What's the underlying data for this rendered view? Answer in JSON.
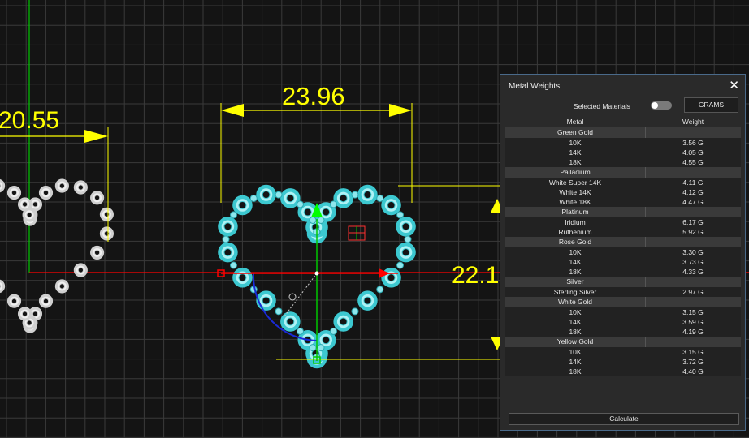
{
  "viewport": {
    "dimension_left": "20.55",
    "dimension_center": "23.96",
    "dimension_right": "22.1"
  },
  "panel": {
    "title": "Metal Weights",
    "close_icon": "close-icon",
    "selected_materials_label": "Selected Materials",
    "units_button": "GRAMS",
    "column_metal": "Metal",
    "column_weight": "Weight",
    "calculate_label": "Calculate",
    "groups": [
      {
        "name": "Green Gold",
        "rows": [
          {
            "metal": "10K",
            "weight": "3.56 G"
          },
          {
            "metal": "14K",
            "weight": "4.05 G"
          },
          {
            "metal": "18K",
            "weight": "4.55 G"
          }
        ]
      },
      {
        "name": "Palladium",
        "rows": [
          {
            "metal": "White Super 14K",
            "weight": "4.11 G"
          },
          {
            "metal": "White 14K",
            "weight": "4.12 G"
          },
          {
            "metal": "White 18K",
            "weight": "4.47 G"
          }
        ]
      },
      {
        "name": "Platinum",
        "rows": [
          {
            "metal": "Iridium",
            "weight": "6.17 G"
          },
          {
            "metal": "Ruthenium",
            "weight": "5.92 G"
          }
        ]
      },
      {
        "name": "Rose Gold",
        "rows": [
          {
            "metal": "10K",
            "weight": "3.30 G"
          },
          {
            "metal": "14K",
            "weight": "3.73 G"
          },
          {
            "metal": "18K",
            "weight": "4.33 G"
          }
        ]
      },
      {
        "name": "Silver",
        "rows": [
          {
            "metal": "Sterling Silver",
            "weight": "2.97 G"
          }
        ]
      },
      {
        "name": "White Gold",
        "rows": [
          {
            "metal": "10K",
            "weight": "3.15 G"
          },
          {
            "metal": "14K",
            "weight": "3.59 G"
          },
          {
            "metal": "18K",
            "weight": "4.19 G"
          }
        ]
      },
      {
        "name": "Yellow Gold",
        "rows": [
          {
            "metal": "10K",
            "weight": "3.15 G"
          },
          {
            "metal": "14K",
            "weight": "3.72 G"
          },
          {
            "metal": "18K",
            "weight": "4.40 G"
          }
        ]
      }
    ]
  },
  "colors": {
    "background": "#141414",
    "grid": "#3a3a3a",
    "dimension": "#ffff00",
    "gem": "#3cc8d0",
    "axis_x": "#ff0000",
    "axis_y": "#00c800",
    "gizmo_arc": "#1a2ad8"
  }
}
